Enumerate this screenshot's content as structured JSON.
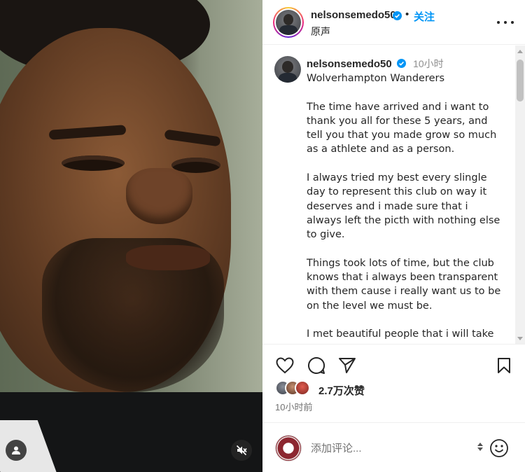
{
  "post": {
    "username": "nelsonsemedo50",
    "follow_label": "关注",
    "audio_label": "原声",
    "separator": "•"
  },
  "caption": {
    "username": "nelsonsemedo50",
    "time": "10小时",
    "paragraphs": [
      "Wolverhampton Wanderers",
      "The time have arrived and i want to thank you all for these 5 years, and tell you that you made grow so much as a athlete and as a person.",
      "I always tried my best every slingle day to represent this club on way it deserves and i made sure that i always left the picth with nothing else to give.",
      "Things took lots of time, but the club knows that i always been transparent with them cause i really want us to be on the level we must be.",
      "I met beautiful people that i will take"
    ]
  },
  "engagement": {
    "likes": "2.7万次赞",
    "posted_ago": "10小时前"
  },
  "comment": {
    "placeholder": "添加评论..."
  },
  "colors": {
    "follow_blue": "#0095f6",
    "verified_blue": "#0095f6"
  },
  "icons": {
    "like": "heart-icon",
    "comment": "comment-icon",
    "share": "send-icon",
    "save": "bookmark-icon",
    "more": "more-dots-icon",
    "user": "user-tag-icon",
    "mute": "speaker-muted-icon",
    "emoji": "emoji-icon"
  }
}
